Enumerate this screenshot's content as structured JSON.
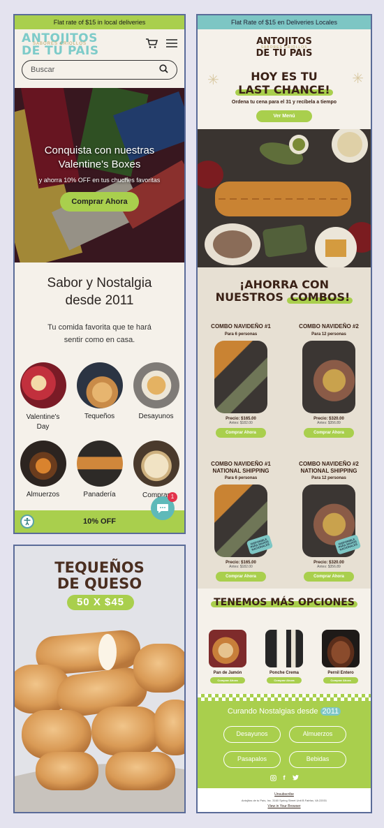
{
  "mobile": {
    "shipping_bar": "Flat rate of $15 in local deliveries",
    "logo": {
      "line1": "ANTOJITOS",
      "tagline": "SABORES CRIOLLOS",
      "line2": "DE TU PAIS"
    },
    "search_placeholder": "Buscar",
    "hero": {
      "title_line1": "Conquista con nuestras",
      "title_line2": "Valentine's Boxes",
      "subtitle": "y ahorra 10% OFF en tus chuches favoritas",
      "button": "Comprar Ahora"
    },
    "sabor": {
      "title_line1": "Sabor y Nostalgia",
      "title_line2": "desde 2011",
      "sub_line1": "Tu comida favorita que te hará",
      "sub_line2": "sentir como en casa."
    },
    "categories": [
      {
        "label": "Valentine's Day"
      },
      {
        "label": "Tequeños"
      },
      {
        "label": "Desayunos"
      },
      {
        "label": "Almuerzos"
      },
      {
        "label": "Panadería"
      },
      {
        "label": "Comprar To"
      }
    ],
    "discount_bar": "10% OFF",
    "chat_badge": "1"
  },
  "tequenos": {
    "title_line1": "TEQUEÑOS",
    "title_line2": "DE QUESO",
    "price": "50 X $45"
  },
  "email": {
    "shipping_bar": "Flat Rate of $15 en Deliveries Locales",
    "logo": {
      "line1": "ANTOJITOS",
      "tagline": "SABORES CRIOLLOS",
      "line2": "DE TU PAIS"
    },
    "hoy_line1": "HOY ES TU",
    "hoy_line2": "LAST CHANCE!",
    "ordena": "Ordena tu cena para el 31 y recíbela a tiempo",
    "ver_menu": "Ver Menú",
    "ahorra_line1": "¡AHORRA CON",
    "ahorra_line2a": "NUESTROS ",
    "ahorra_line2b": "COMBOS!",
    "combos": [
      {
        "name_line1": "COMBO NAVIDEÑO #1",
        "name_line2": "",
        "people": "Para 6 personas",
        "price": "Precio: $165.00",
        "antes": "Antes: $182.00",
        "button": "Comprar Ahora",
        "badge": ""
      },
      {
        "name_line1": "COMBO NAVIDEÑO #2",
        "name_line2": "",
        "people": "Para 12 personas",
        "price": "Precio: $320.00",
        "antes": "Antes: $356.89",
        "button": "Comprar Ahora",
        "badge": ""
      },
      {
        "name_line1": "COMBO NAVIDEÑO #1",
        "name_line2": "NATIONAL SHIPPING",
        "people": "Para 6 personas",
        "price": "Precio: $165.00",
        "antes": "Antes: $182.00",
        "button": "Comprar Ahora",
        "badge": "DISPONIBLE PARA ENVIOS NACIONALES"
      },
      {
        "name_line1": "COMBO NAVIDEÑO #2",
        "name_line2": "NATIONAL SHIPPING",
        "people": "Para 12 personas",
        "price": "Precio: $320.00",
        "antes": "Antes: $356.89",
        "button": "Comprar Ahora",
        "badge": "DISPONIBLE PARA ENVIOS NACIONALES"
      }
    ],
    "tenemos": "TENEMOS MÁS OPCIONES",
    "options": [
      {
        "name": "Pan de Jamón",
        "button": "Comprar Ahora"
      },
      {
        "name": "Ponche Crema",
        "button": "Comprar Ahora"
      },
      {
        "name": "Pernil Entero",
        "button": "Comprar Ahora"
      }
    ],
    "curando": "Curando Nostalgias desde ",
    "curando_year": "2011",
    "nav_pills": [
      "Desayunos",
      "Almuerzos",
      "Pasapalos",
      "Bebidas"
    ],
    "footer": {
      "unsubscribe": "Unsubscribe",
      "address": "Antojitos de tu País, Inc. 3160 Spring Street Unit B Fairfax, VA 22031",
      "view_browser": "View in Your Browser"
    }
  },
  "colors": {
    "green": "#a9cf4d",
    "teal": "#7dc6c4",
    "brown": "#3a2116",
    "frame": "#5a6b98"
  }
}
